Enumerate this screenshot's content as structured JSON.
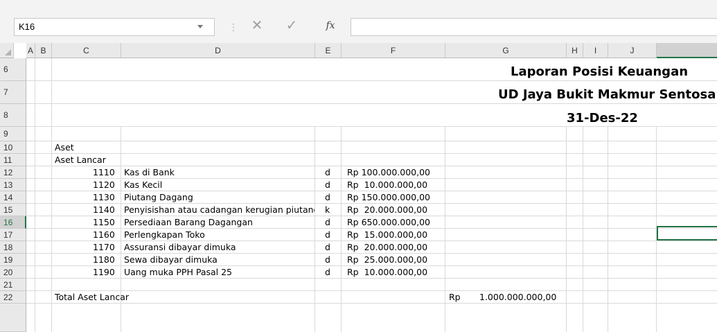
{
  "name_box": {
    "value": "K16"
  },
  "formula_bar": {
    "cancel_glyph": "✕",
    "enter_glyph": "✓",
    "fx_label": "fx",
    "value": ""
  },
  "columns": [
    "A",
    "B",
    "C",
    "D",
    "E",
    "F",
    "G",
    "H",
    "I",
    "J"
  ],
  "selected_column": "K",
  "rows": [
    "6",
    "7",
    "8",
    "9",
    "10",
    "11",
    "12",
    "13",
    "14",
    "15",
    "16",
    "17",
    "18",
    "19",
    "20",
    "21",
    "22"
  ],
  "selected_row": "16",
  "report": {
    "title": "Laporan Posisi Keuangan",
    "company": "UD Jaya Bukit Makmur Sentosa",
    "date": "31-Des-22"
  },
  "sections": {
    "asset": "Aset",
    "current_asset": "Aset Lancar"
  },
  "accounts": [
    {
      "code": "1110",
      "name": "Kas di Bank",
      "dk": "d",
      "amount": "Rp 100.000.000,00"
    },
    {
      "code": "1120",
      "name": "Kas Kecil",
      "dk": "d",
      "amount": "Rp  10.000.000,00"
    },
    {
      "code": "1130",
      "name": "Piutang Dagang",
      "dk": "d",
      "amount": "Rp 150.000.000,00"
    },
    {
      "code": "1140",
      "name": "Penyisishan atau cadangan kerugian piutang",
      "dk": "k",
      "amount": "Rp  20.000.000,00"
    },
    {
      "code": "1150",
      "name": "Persediaan Barang Dagangan",
      "dk": "d",
      "amount": "Rp 650.000.000,00"
    },
    {
      "code": "1160",
      "name": "Perlengkapan Toko",
      "dk": "d",
      "amount": "Rp  15.000.000,00"
    },
    {
      "code": "1170",
      "name": "Assuransi dibayar dimuka",
      "dk": "d",
      "amount": "Rp  20.000.000,00"
    },
    {
      "code": "1180",
      "name": "Sewa dibayar dimuka",
      "dk": "d",
      "amount": "Rp  25.000.000,00"
    },
    {
      "code": "1190",
      "name": "Uang muka PPH Pasal 25",
      "dk": "d",
      "amount": "Rp  10.000.000,00"
    }
  ],
  "total": {
    "label": "Total Aset Lancar",
    "currency": "Rp",
    "amount": "1.000.000.000,00"
  }
}
